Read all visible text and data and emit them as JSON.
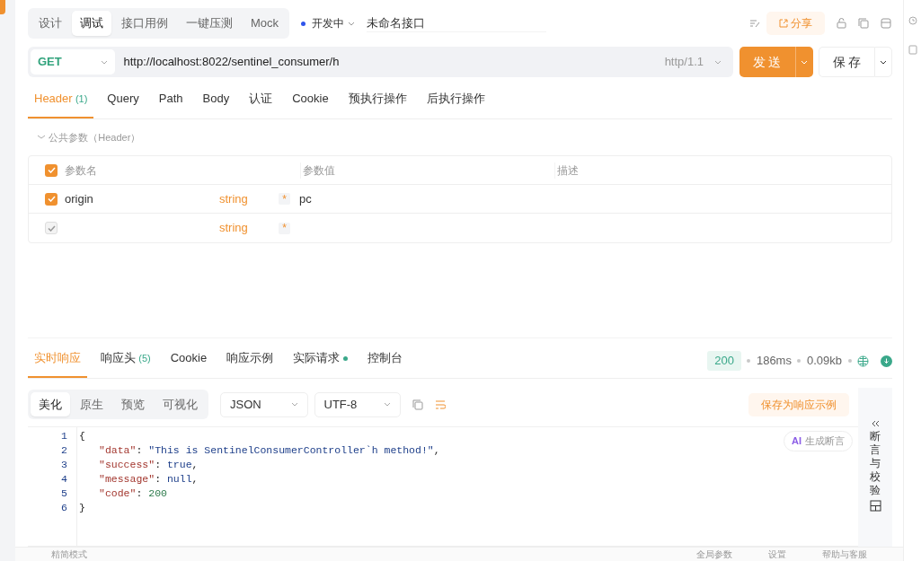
{
  "mode_tabs": [
    {
      "label": "设计",
      "selected": false
    },
    {
      "label": "调试",
      "selected": true
    },
    {
      "label": "接口用例",
      "selected": false
    },
    {
      "label": "一键压测",
      "selected": false
    },
    {
      "label": "Mock",
      "selected": false
    }
  ],
  "status": {
    "label": "开发中",
    "color": "#2f54eb"
  },
  "api_name": "未命名接口",
  "share_label": "分享",
  "request": {
    "method": "GET",
    "url": "http://localhost:8022/sentinel_consumer/h",
    "protocol": "http/1.1",
    "send_label": "发 送",
    "save_label": "保 存"
  },
  "request_tabs": [
    {
      "label": "Header",
      "count": "(1)",
      "selected": true
    },
    {
      "label": "Query",
      "selected": false
    },
    {
      "label": "Path",
      "selected": false
    },
    {
      "label": "Body",
      "selected": false
    },
    {
      "label": "认证",
      "selected": false
    },
    {
      "label": "Cookie",
      "selected": false
    },
    {
      "label": "预执行操作",
      "selected": false
    },
    {
      "label": "后执行操作",
      "selected": false
    }
  ],
  "public_params_label": "公共参数（Header）",
  "params_table": {
    "columns": [
      "参数名",
      "参数值",
      "描述"
    ],
    "header_checked": true,
    "rows": [
      {
        "checked": true,
        "disabled": false,
        "name": "origin",
        "type": "string",
        "required": "*",
        "value": "pc"
      },
      {
        "checked": true,
        "disabled": true,
        "name": "",
        "type": "string",
        "required": "*",
        "value": ""
      }
    ]
  },
  "response_tabs": [
    {
      "label": "实时响应",
      "selected": true
    },
    {
      "label": "响应头",
      "count": "(5)",
      "selected": false
    },
    {
      "label": "Cookie",
      "selected": false
    },
    {
      "label": "响应示例",
      "selected": false
    },
    {
      "label": "实际请求",
      "dot": true,
      "selected": false
    },
    {
      "label": "控制台",
      "selected": false
    }
  ],
  "response_meta": {
    "status_code": "200",
    "time": "186ms",
    "size": "0.09kb"
  },
  "view_tabs": [
    {
      "label": "美化",
      "selected": true
    },
    {
      "label": "原生",
      "selected": false
    },
    {
      "label": "预览",
      "selected": false
    },
    {
      "label": "可视化",
      "selected": false
    }
  ],
  "format_select": "JSON",
  "encoding_select": "UTF-8",
  "save_example_label": "保存为响应示例",
  "ai_label": "AI",
  "ai_button_label": "生成断言",
  "assert_panel_label": "断言与校验",
  "code_lines": [
    {
      "number": "1",
      "tokens": [
        {
          "kind": "punct",
          "text": "{"
        }
      ]
    },
    {
      "number": "2",
      "tokens": [
        {
          "kind": "key",
          "text": "\"data\""
        },
        {
          "kind": "punct",
          "text": ": "
        },
        {
          "kind": "string",
          "text": "\"This is SentinelConsumerController`h method!\""
        },
        {
          "kind": "punct",
          "text": ","
        }
      ]
    },
    {
      "number": "3",
      "tokens": [
        {
          "kind": "key",
          "text": "\"success\""
        },
        {
          "kind": "punct",
          "text": ": "
        },
        {
          "kind": "keyword",
          "text": "true"
        },
        {
          "kind": "punct",
          "text": ","
        }
      ]
    },
    {
      "number": "4",
      "tokens": [
        {
          "kind": "key",
          "text": "\"message\""
        },
        {
          "kind": "punct",
          "text": ": "
        },
        {
          "kind": "keyword",
          "text": "null"
        },
        {
          "kind": "punct",
          "text": ","
        }
      ]
    },
    {
      "number": "5",
      "tokens": [
        {
          "kind": "key",
          "text": "\"code\""
        },
        {
          "kind": "punct",
          "text": ": "
        },
        {
          "kind": "number",
          "text": "200"
        }
      ]
    },
    {
      "number": "6",
      "tokens": [
        {
          "kind": "punct",
          "text": "}"
        }
      ]
    }
  ],
  "status_bar": [
    "精简模式",
    "全局参数",
    "设置",
    "帮助与客服"
  ]
}
